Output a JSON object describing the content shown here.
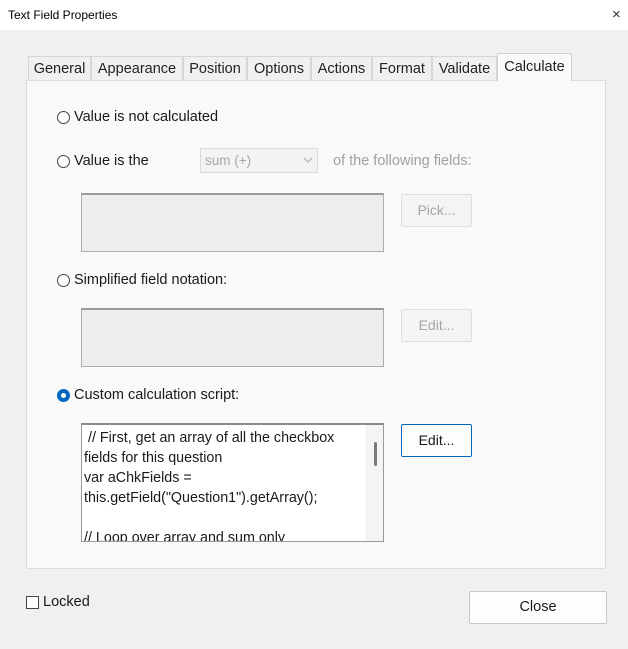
{
  "window": {
    "title": "Text Field Properties",
    "close_glyph": "×"
  },
  "tabs": [
    {
      "label": "General"
    },
    {
      "label": "Appearance"
    },
    {
      "label": "Position"
    },
    {
      "label": "Options"
    },
    {
      "label": "Actions"
    },
    {
      "label": "Format"
    },
    {
      "label": "Validate"
    },
    {
      "label": "Calculate"
    }
  ],
  "active_tab": "Calculate",
  "calculate": {
    "option_not_calculated": "Value is not calculated",
    "option_value_is_the": "Value is the",
    "operation_value": "sum (+)",
    "of_following_fields": "of the following fields:",
    "pick_button": "Pick...",
    "option_simplified": "Simplified field notation:",
    "edit_simplified_button": "Edit...",
    "option_custom": "Custom calculation script:",
    "edit_custom_button": "Edit...",
    "selected_option": "Custom calculation script:",
    "script": " // First, get an array of all the checkbox fields for this question\nvar aChkFields = this.getField(\"Question1\").getArray();\n\n// Loop over array and sum only"
  },
  "footer": {
    "locked_label": "Locked",
    "locked_checked": false,
    "close_button": "Close"
  },
  "colors": {
    "accent": "#0067c0",
    "disabled_text": "#a0a0a0",
    "panel_background": "#f9f9f9"
  },
  "icons": {
    "close": "close-icon",
    "dropdown": "chevron-down-icon"
  }
}
